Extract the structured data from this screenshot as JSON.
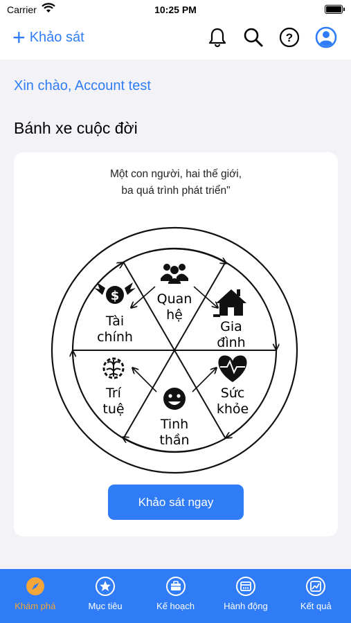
{
  "status": {
    "carrier": "Carrier",
    "time": "10:25 PM"
  },
  "nav": {
    "add_label": "Khảo sát"
  },
  "greeting": "Xin chào, Account test",
  "section_title": "Bánh xe cuộc đời",
  "card": {
    "quote_line1": "Một con người, hai thế giới,",
    "quote_line2": "ba quá trình phát triển\"",
    "cta_label": "Khảo sát ngay"
  },
  "wheel": {
    "segments": [
      {
        "line1": "Quan",
        "line2": "hệ",
        "icon": "people-icon"
      },
      {
        "line1": "Gia",
        "line2": "đình",
        "icon": "house-icon"
      },
      {
        "line1": "Sức",
        "line2": "khỏe",
        "icon": "heart-pulse-icon"
      },
      {
        "line1": "Tinh",
        "line2": "thần",
        "icon": "smiley-icon"
      },
      {
        "line1": "Trí",
        "line2": "tuệ",
        "icon": "brain-icon"
      },
      {
        "line1": "Tài",
        "line2": "chính",
        "icon": "money-icon"
      }
    ]
  },
  "tabs": [
    {
      "label": "Khám phá",
      "icon": "compass-icon",
      "active": true
    },
    {
      "label": "Mục tiêu",
      "icon": "star-icon",
      "active": false
    },
    {
      "label": "Kế hoạch",
      "icon": "briefcase-icon",
      "active": false
    },
    {
      "label": "Hành động",
      "icon": "calendar-icon",
      "active": false
    },
    {
      "label": "Kết quả",
      "icon": "chart-icon",
      "active": false
    }
  ],
  "colors": {
    "accent": "#2f7cf6",
    "active_tab": "#f4a63a",
    "background": "#f2f2f7"
  }
}
